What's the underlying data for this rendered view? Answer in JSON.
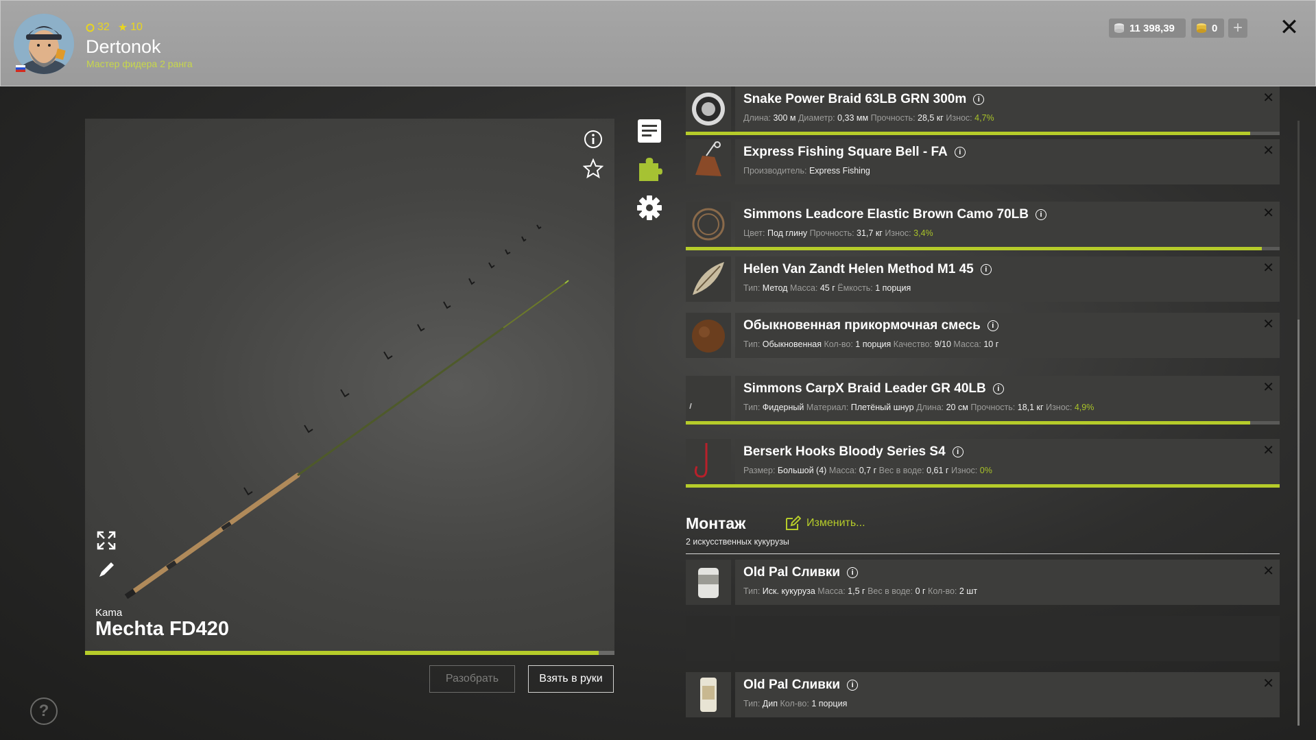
{
  "header": {
    "level": "32",
    "stars": "10",
    "username": "Dertonok",
    "rank": "Мастер фидера 2 ранга",
    "silver": "11 398,39",
    "gold": "0",
    "plus_label": "+",
    "close_label": "✕"
  },
  "rod": {
    "brand": "Kama",
    "name": "Mechta FD420",
    "condition_fraction": 0.97
  },
  "buttons": {
    "disassemble": "Разобрать",
    "take": "Взять в руки",
    "help": "?"
  },
  "side_tabs": [
    "list-icon",
    "puzzle-icon",
    "gear-icon"
  ],
  "items": [
    {
      "title": "Snake Power Braid 63LB GRN 300m",
      "props": [
        [
          "Длина:",
          "300 м"
        ],
        [
          "Диаметр:",
          "0,33 мм"
        ],
        [
          "Прочность:",
          "28,5 кг"
        ]
      ],
      "wear_label": "Износ:",
      "wear": "4,7%",
      "condition_fraction": 0.95
    },
    {
      "title": "Express Fishing Square Bell - FA",
      "props": [
        [
          "Производитель:",
          "Express Fishing"
        ]
      ]
    },
    {
      "title": "Simmons Leadcore Elastic Brown Camo 70LB",
      "props": [
        [
          "Цвет:",
          "Под глину"
        ],
        [
          "Прочность:",
          "31,7 кг"
        ]
      ],
      "wear_label": "Износ:",
      "wear": "3,4%",
      "condition_fraction": 0.97
    },
    {
      "title": "Helen Van Zandt Helen Method M1 45",
      "props": [
        [
          "Тип:",
          "Метод"
        ],
        [
          "Масса:",
          "45 г"
        ],
        [
          "Ёмкость:",
          "1 порция"
        ]
      ]
    },
    {
      "title": "Обыкновенная прикормочная смесь",
      "props": [
        [
          "Тип:",
          "Обыкновенная"
        ],
        [
          "Кол-во:",
          "1 порция"
        ],
        [
          "Качество:",
          "9/10"
        ],
        [
          "Масса:",
          "10 г"
        ]
      ]
    },
    {
      "title": "Simmons CarpX Braid Leader GR 40LB",
      "props": [
        [
          "Тип:",
          "Фидерный"
        ],
        [
          "Материал:",
          "Плетёный шнур"
        ],
        [
          "Длина:",
          "20 см"
        ],
        [
          "Прочность:",
          "18,1 кг"
        ]
      ],
      "wear_label": "Износ:",
      "wear": "4,9%",
      "condition_fraction": 0.95
    },
    {
      "title": "Berserk Hooks Bloody Series S4",
      "props": [
        [
          "Размер:",
          "Большой (4)"
        ],
        [
          "Масса:",
          "0,7 г"
        ],
        [
          "Вес в воде:",
          "0,61 г"
        ]
      ],
      "wear_label": "Износ:",
      "wear": "0%",
      "condition_fraction": 1.0
    }
  ],
  "montage": {
    "title": "Монтаж",
    "edit_label": "Изменить...",
    "subtitle": "2 искусственных кукурузы"
  },
  "baits": [
    {
      "title": "Old Pal Сливки",
      "props": [
        [
          "Тип:",
          "Иск. кукуруза"
        ],
        [
          "Масса:",
          "1,5 г"
        ],
        [
          "Вес в воде:",
          "0 г"
        ],
        [
          "Кол-во:",
          "2 шт"
        ]
      ]
    },
    {
      "title": "Old Pal Сливки",
      "props": [
        [
          "Тип:",
          "Дип"
        ],
        [
          "Кол-во:",
          "1 порция"
        ]
      ]
    }
  ]
}
